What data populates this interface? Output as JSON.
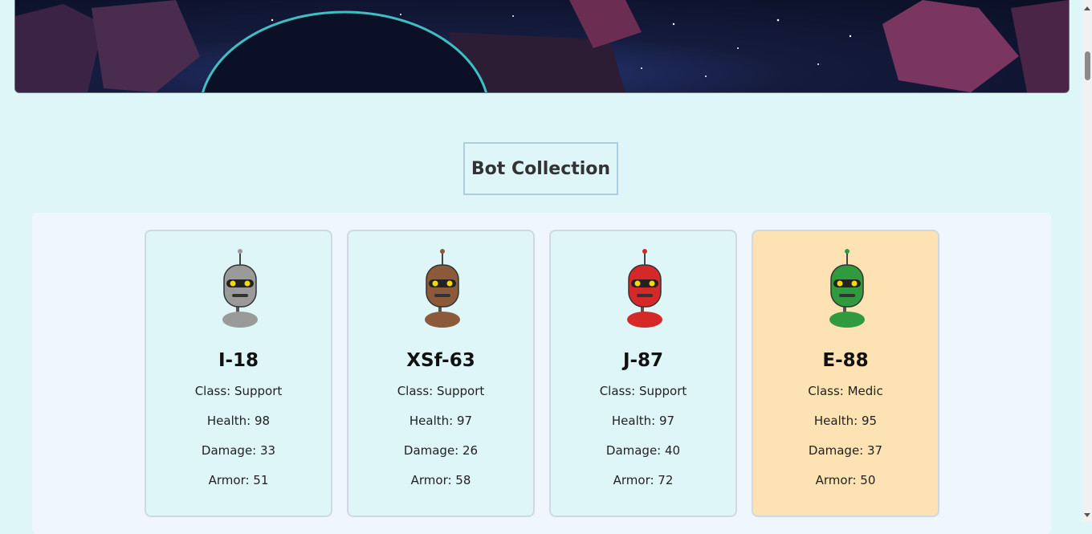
{
  "section_title": "Bot Collection",
  "bots": [
    {
      "name": "I-18",
      "class": "Class: Support",
      "health": "Health: 98",
      "damage": "Damage: 33",
      "armor": "Armor: 51",
      "highlighted": false,
      "color": "#9a9a9a"
    },
    {
      "name": "XSf-63",
      "class": "Class: Support",
      "health": "Health: 97",
      "damage": "Damage: 26",
      "armor": "Armor: 58",
      "highlighted": false,
      "color": "#8b5a3a"
    },
    {
      "name": "J-87",
      "class": "Class: Support",
      "health": "Health: 97",
      "damage": "Damage: 40",
      "armor": "Armor: 72",
      "highlighted": false,
      "color": "#d62828"
    },
    {
      "name": "E-88",
      "class": "Class: Medic",
      "health": "Health: 95",
      "damage": "Damage: 37",
      "armor": "Armor: 50",
      "highlighted": true,
      "color": "#2f9a3e"
    }
  ],
  "colors": {
    "background": "#dff6f8",
    "highlight_card": "#fde2b3",
    "card_border": "#cfd8e3"
  }
}
